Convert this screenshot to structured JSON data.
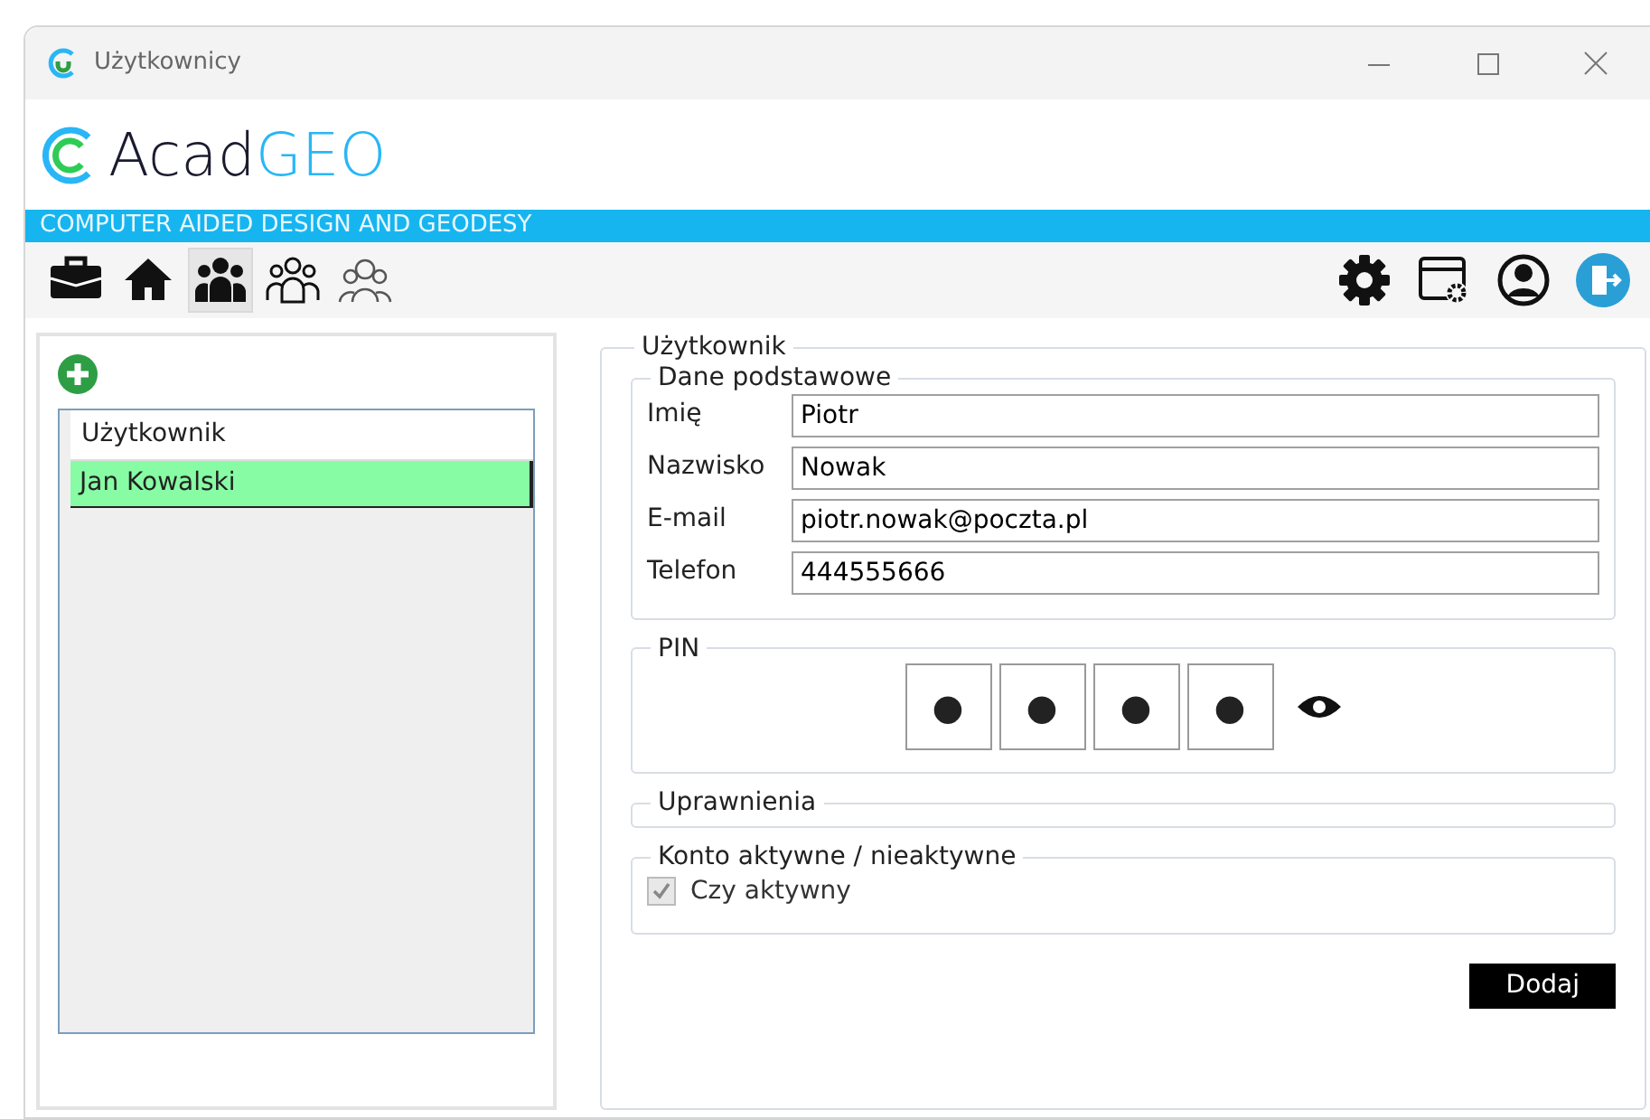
{
  "window": {
    "title": "Użytkownicy"
  },
  "logo": {
    "part_1": "Acad",
    "part_2": "GEO"
  },
  "banner": "COMPUTER AIDED DESIGN AND GEODESY",
  "toolbar": {
    "left": [
      {
        "kind": "briefcase",
        "selected": false
      },
      {
        "kind": "home",
        "selected": false
      },
      {
        "kind": "users-filled",
        "selected": true
      },
      {
        "kind": "users-outline",
        "selected": false
      },
      {
        "kind": "users-grey",
        "selected": false
      }
    ],
    "right": [
      {
        "kind": "gear"
      },
      {
        "kind": "window-settings"
      },
      {
        "kind": "account"
      },
      {
        "kind": "logout"
      }
    ]
  },
  "user_list": {
    "column": "Użytkownik",
    "rows": [
      {
        "name": "Jan Kowalski",
        "selected": true
      }
    ]
  },
  "form": {
    "title": "Użytkownik",
    "basic": {
      "title": "Dane podstawowe",
      "fields": [
        {
          "label": "Imię",
          "value": "Piotr"
        },
        {
          "label": "Nazwisko",
          "value": "Nowak"
        },
        {
          "label": "E-mail",
          "value": "piotr.nowak@poczta.pl"
        },
        {
          "label": "Telefon",
          "value": "444555666"
        }
      ]
    },
    "pin": {
      "title": "PIN",
      "digits": [
        "●",
        "●",
        "●",
        "●"
      ]
    },
    "permissions": {
      "title": "Uprawnienia"
    },
    "account": {
      "title": "Konto aktywne / nieaktywne",
      "checkbox": {
        "label": "Czy aktywny",
        "checked": true,
        "disabled": true
      }
    },
    "submit": "Dodaj"
  }
}
